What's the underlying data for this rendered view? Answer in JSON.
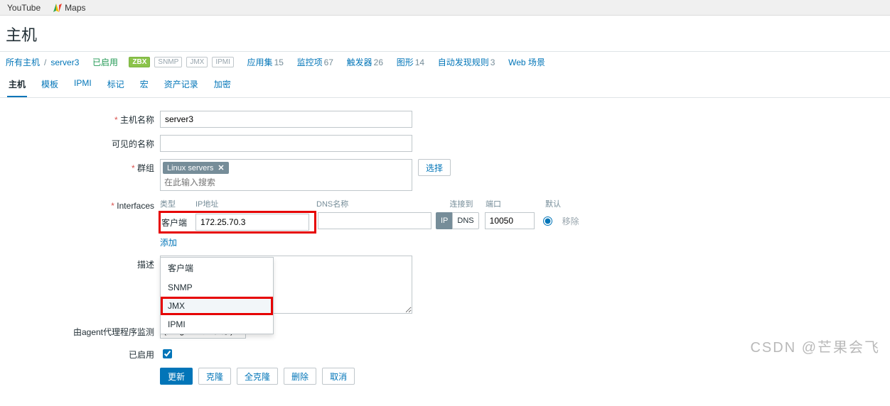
{
  "bookmarks": {
    "youtube": "YouTube",
    "maps": "Maps"
  },
  "page_title": "主机",
  "breadcrumb": {
    "all_hosts": "所有主机",
    "current": "server3",
    "status": "已启用",
    "tags": [
      "ZBX",
      "SNMP",
      "JMX",
      "IPMI"
    ],
    "links": [
      {
        "label": "应用集",
        "count": "15"
      },
      {
        "label": "监控项",
        "count": "67"
      },
      {
        "label": "触发器",
        "count": "26"
      },
      {
        "label": "图形",
        "count": "14"
      },
      {
        "label": "自动发现规则",
        "count": "3"
      },
      {
        "label": "Web 场景",
        "count": ""
      }
    ]
  },
  "tabs": [
    "主机",
    "模板",
    "IPMI",
    "标记",
    "宏",
    "资产记录",
    "加密"
  ],
  "form": {
    "host_label": "主机名称",
    "host_value": "server3",
    "visible_label": "可见的名称",
    "visible_value": "",
    "groups_label": "群组",
    "groups_tag": "Linux servers",
    "groups_placeholder": "在此输入搜索",
    "groups_select_btn": "选择",
    "interfaces_label": "Interfaces",
    "iface_head": {
      "type": "类型",
      "ip": "IP地址",
      "dns": "DNS名称",
      "conn": "连接到",
      "port": "端口",
      "def": "默认"
    },
    "iface_row": {
      "type": "客户端",
      "ip": "172.25.70.3",
      "dns": "",
      "conn_ip": "IP",
      "conn_dns": "DNS",
      "port": "10050",
      "remove": "移除"
    },
    "add_link": "添加",
    "iface_dropdown": [
      "客户端",
      "SNMP",
      "JMX",
      "IPMI"
    ],
    "desc_label": "描述",
    "proxy_label": "由agent代理程序监测",
    "proxy_value": "(无agent代理程序)",
    "enabled_label": "已启用",
    "buttons": {
      "update": "更新",
      "clone": "克隆",
      "fullclone": "全克隆",
      "delete": "删除",
      "cancel": "取消"
    }
  },
  "watermark": "CSDN @芒果会飞"
}
